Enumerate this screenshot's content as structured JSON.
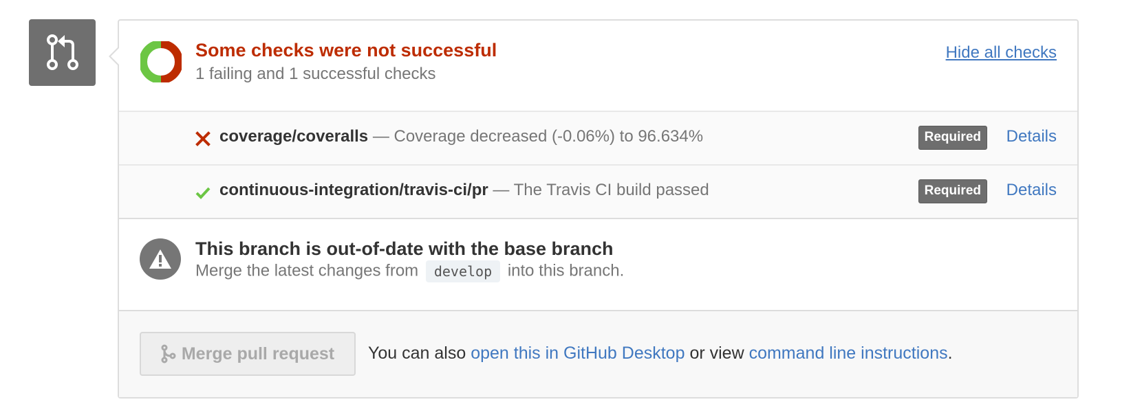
{
  "avatar": {
    "icon": "git-pull-request-icon",
    "color": "#6f6f6f"
  },
  "status": {
    "icon": "status-ring-icon",
    "title": "Some checks were not successful",
    "subtitle": "1 failing and 1 successful checks",
    "hide_link": "Hide all checks",
    "title_color": "#bd2c00",
    "ring_colors": {
      "success": "#6cc644",
      "failure": "#bd2c00"
    }
  },
  "checks": [
    {
      "state": "failure",
      "icon": "x-icon",
      "name": "coverage/coveralls",
      "description": "— Coverage decreased (-0.06%) to 96.634%",
      "badge": "Required",
      "details": "Details"
    },
    {
      "state": "success",
      "icon": "check-icon",
      "name": "continuous-integration/travis-ci/pr",
      "description": "— The Travis CI build passed",
      "badge": "Required",
      "details": "Details"
    }
  ],
  "branch": {
    "icon": "alert-icon",
    "title": "This branch is out-of-date with the base branch",
    "sub_prefix": "Merge the latest changes from",
    "base_branch": "develop",
    "sub_suffix": "into this branch."
  },
  "merge": {
    "button_icon": "git-merge-icon",
    "button_label": "Merge pull request",
    "text_prefix": "You can also",
    "desktop_link": "open this in GitHub Desktop",
    "text_middle": "or view",
    "cli_link": "command line instructions",
    "text_suffix": "."
  },
  "colors": {
    "link": "#4078c0",
    "success": "#6cc644",
    "failure": "#bd2c00",
    "muted": "#767676"
  }
}
